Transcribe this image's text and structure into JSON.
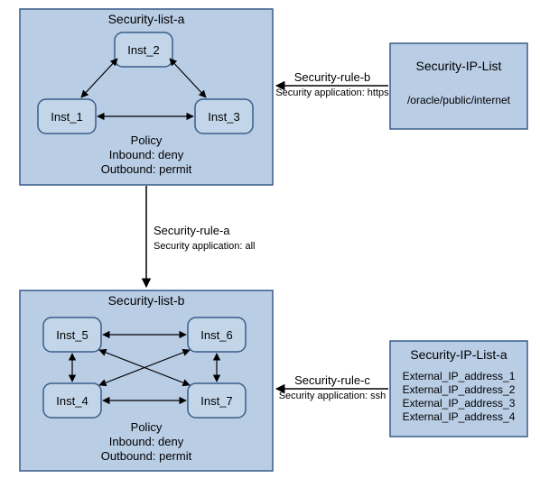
{
  "seclist_a": {
    "title": "Security-list-a",
    "inst1": "Inst_1",
    "inst2": "Inst_2",
    "inst3": "Inst_3",
    "policy_label": "Policy",
    "policy_inbound": "Inbound: deny",
    "policy_outbound": "Outbound: permit"
  },
  "seclist_b": {
    "title": "Security-list-b",
    "inst4": "Inst_4",
    "inst5": "Inst_5",
    "inst6": "Inst_6",
    "inst7": "Inst_7",
    "policy_label": "Policy",
    "policy_inbound": "Inbound: deny",
    "policy_outbound": "Outbound: permit"
  },
  "iplist1": {
    "title": "Security-IP-List",
    "line1": "/oracle/public/internet"
  },
  "iplist2": {
    "title": "Security-IP-List-a",
    "line1": "External_IP_address_1",
    "line2": "External_IP_address_2",
    "line3": "External_IP_address_3",
    "line4": "External_IP_address_4"
  },
  "rule_a": {
    "title": "Security-rule-a",
    "sub": "Security application: all"
  },
  "rule_b": {
    "title": "Security-rule-b",
    "sub": "Security application: https"
  },
  "rule_c": {
    "title": "Security-rule-c",
    "sub": "Security application: ssh"
  }
}
